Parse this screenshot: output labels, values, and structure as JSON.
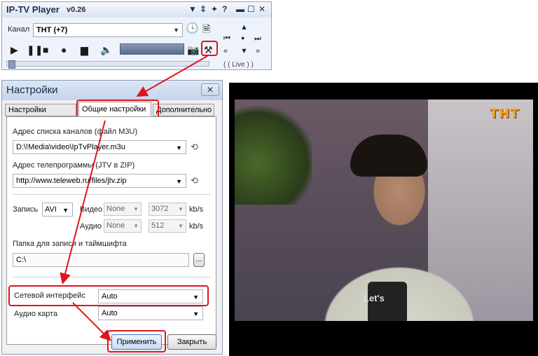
{
  "player": {
    "title": "IP-TV Player",
    "version": "v0.26",
    "channel_label": "Канал",
    "channel_value": "ТНТ (+7)",
    "live": "( ( Live ) )"
  },
  "settings": {
    "title": "Настройки",
    "tabs": [
      "Настройки канала",
      "Общие настройки",
      "Дополнительно"
    ],
    "playlist_label": "Адрес списка каналов (файл M3U)",
    "playlist_value": "D:\\!Media\\video\\IpTvPlayer.m3u",
    "epg_label": "Адрес телепрограммы (JTV в ZIP)",
    "epg_value": "http://www.teleweb.ru/files/jtv.zip",
    "record_label": "Запись",
    "record_format": "AVI",
    "video_label": "Видео",
    "video_codec": "None",
    "video_bitrate": "3072",
    "audio_label": "Аудио",
    "audio_codec": "None",
    "audio_bitrate": "512",
    "unit": "kb/s",
    "folder_label": "Папка для записи и таймшифта",
    "folder_value": "C:\\",
    "browse_label": "...",
    "net_label": "Сетевой интерфейс",
    "net_value": "Auto",
    "audio_card_label": "Аудио карта",
    "audio_card_value": "Auto",
    "apply_label": "Применить",
    "close_label": "Закрыть"
  },
  "video": {
    "channel_logo": "ТНТ",
    "mic_text": "Let's"
  },
  "colors": {
    "highlight": "#e0151b",
    "title_blue": "#1f2f50"
  }
}
